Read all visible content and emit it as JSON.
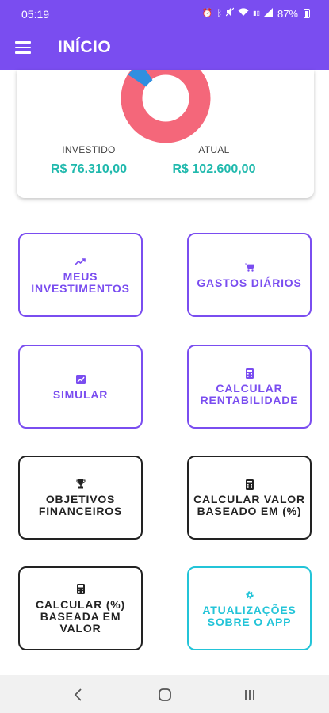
{
  "status_bar": {
    "time": "05:19",
    "battery_percent": "87%",
    "icons": [
      "alarm-icon",
      "bluetooth-icon",
      "mute-icon",
      "wifi-icon",
      "data-speed-icon",
      "signal-icon",
      "battery-icon"
    ]
  },
  "app_bar": {
    "title": "INÍCIO",
    "menu_icon": "hamburger-menu-icon"
  },
  "summary": {
    "invested_label": "INVESTIDO",
    "invested_value": "R$ 76.310,00",
    "current_label": "ATUAL",
    "current_value": "R$ 102.600,00",
    "chart_colors": {
      "main": "#f4677a",
      "accent": "#2f8fe0"
    }
  },
  "tiles": [
    {
      "label": "MEUS INVESTIMENTOS",
      "icon": "trending-up-icon",
      "color": "#7a4df0"
    },
    {
      "label": "GASTOS DIÁRIOS",
      "icon": "shopping-cart-icon",
      "color": "#7a4df0"
    },
    {
      "label": "SIMULAR",
      "icon": "chart-box-icon",
      "color": "#7a4df0"
    },
    {
      "label": "CALCULAR RENTABILIDADE",
      "icon": "calculator-icon",
      "color": "#7a4df0"
    },
    {
      "label": "OBJETIVOS FINANCEIROS",
      "icon": "trophy-icon",
      "color": "#222222"
    },
    {
      "label": "CALCULAR VALOR BASEADO EM (%)",
      "icon": "calculator-icon",
      "color": "#222222"
    },
    {
      "label": "CALCULAR (%) BASEADA EM VALOR",
      "icon": "calculator-icon",
      "color": "#222222"
    },
    {
      "label": "ATUALIZAÇÕES SOBRE O APP",
      "icon": "gear-icon",
      "color": "#23c4d8"
    }
  ],
  "nav_bar": {
    "icons": [
      "back-icon",
      "home-icon",
      "recents-icon"
    ]
  }
}
